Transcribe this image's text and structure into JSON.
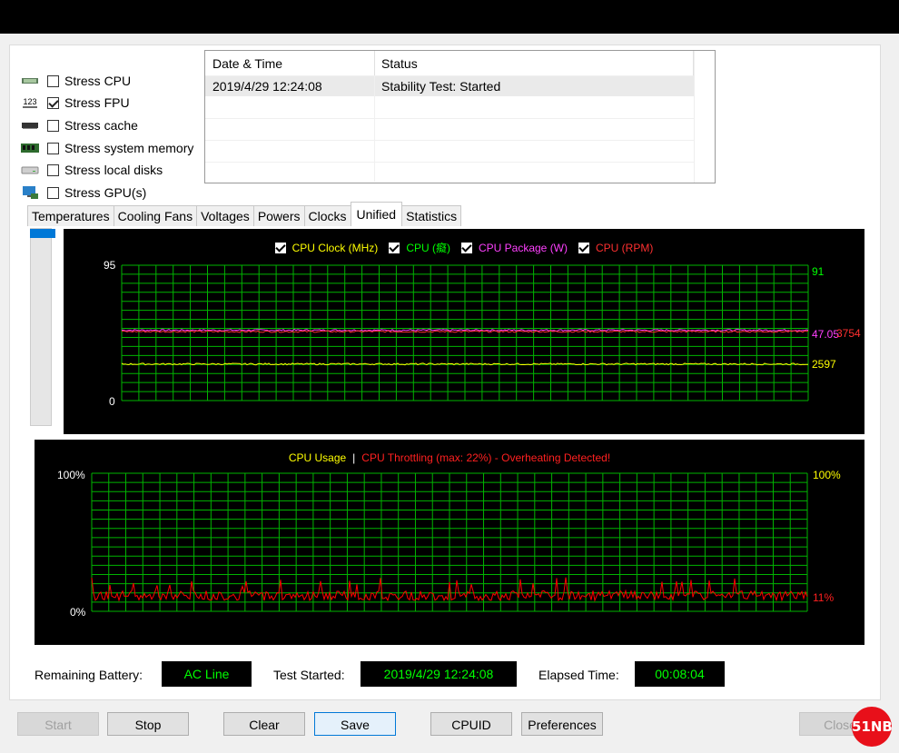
{
  "stress_options": [
    {
      "label": "Stress CPU",
      "checked": false,
      "icon": "cpu-chip-icon"
    },
    {
      "label": "Stress FPU",
      "checked": true,
      "icon": "fpu-123-icon"
    },
    {
      "label": "Stress cache",
      "checked": false,
      "icon": "cache-chip-icon"
    },
    {
      "label": "Stress system memory",
      "checked": false,
      "icon": "memory-module-icon"
    },
    {
      "label": "Stress local disks",
      "checked": false,
      "icon": "disk-icon"
    },
    {
      "label": "Stress GPU(s)",
      "checked": false,
      "icon": "gpu-monitor-icon"
    }
  ],
  "fpu_icon_text": "123",
  "log": {
    "headers": [
      "Date & Time",
      "Status"
    ],
    "rows": [
      {
        "datetime": "2019/4/29 12:24:08",
        "status": "Stability Test: Started"
      }
    ]
  },
  "tabs": [
    "Temperatures",
    "Cooling Fans",
    "Voltages",
    "Powers",
    "Clocks",
    "Unified",
    "Statistics"
  ],
  "active_tab": "Unified",
  "chart_data": [
    {
      "type": "line",
      "legend": [
        {
          "label": "CPU Clock (MHz)",
          "color": "#ffff00"
        },
        {
          "label": "CPU (癡)",
          "color": "#00ff00"
        },
        {
          "label": "CPU Package (W)",
          "color": "#ff40ff"
        },
        {
          "label": "CPU (RPM)",
          "color": "#ff3030"
        }
      ],
      "y_left_max": "95",
      "y_left_min": "0",
      "y_right_top": "91",
      "series": [
        {
          "color": "#ff40ff",
          "end_label": "47.05",
          "level": 0.52
        },
        {
          "color": "#ff3030",
          "end_label": "3754",
          "level": 0.51
        },
        {
          "color": "#ffff00",
          "end_label": "2597",
          "level": 0.27
        }
      ]
    },
    {
      "type": "line",
      "title_usage": "CPU Usage",
      "title_sep": "|",
      "title_throttle": "CPU Throttling (max: 22%) - Overheating Detected!",
      "y_left_top": "100%",
      "y_left_bottom": "0%",
      "y_right_top": "100%",
      "y_right_end": "11%",
      "series": [
        {
          "name": "CPU Throttling",
          "color": "#ff0000",
          "level": 0.1
        }
      ]
    }
  ],
  "info": {
    "battery_label": "Remaining Battery:",
    "battery_value": "AC Line",
    "started_label": "Test Started:",
    "started_value": "2019/4/29 12:24:08",
    "elapsed_label": "Elapsed Time:",
    "elapsed_value": "00:08:04"
  },
  "buttons": {
    "start": "Start",
    "stop": "Stop",
    "clear": "Clear",
    "save": "Save",
    "cpuid": "CPUID",
    "preferences": "Preferences",
    "close": "Close"
  },
  "watermark": "51NB"
}
